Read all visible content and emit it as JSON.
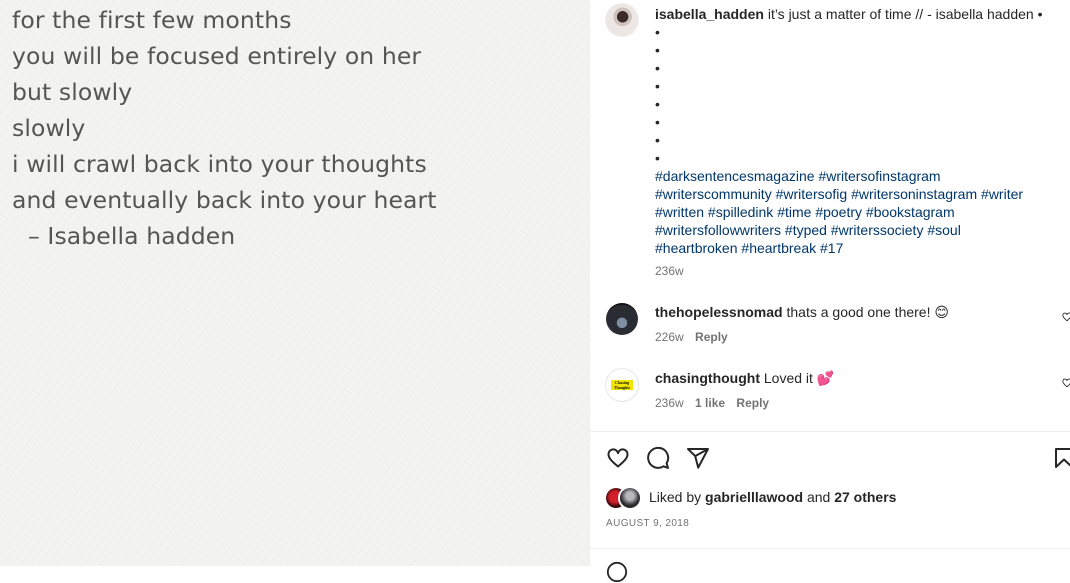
{
  "poem": {
    "lines": [
      "for the first few months",
      "you will be focused entirely on her",
      "but slowly",
      "slowly",
      "i will crawl back into your thoughts",
      "and eventually back into your heart"
    ],
    "author_line": "–   Isabella hadden"
  },
  "caption": {
    "username": "isabella_hadden",
    "text": "it’s just a matter of time // - isabella hadden •",
    "bullets": [
      "•",
      "•",
      "•",
      "•",
      "•",
      "•",
      "•",
      "•"
    ],
    "hashtags": [
      "#darksentencesmagazine",
      "#writersofinstagram",
      "#writerscommunity",
      "#writersofig",
      "#writersoninstagram",
      "#writer",
      "#written",
      "#spilledink",
      "#time",
      "#poetry",
      "#bookstagram",
      "#writersfollowwriters",
      "#typed",
      "#writerssociety",
      "#soul",
      "#heartbroken",
      "#heartbreak",
      "#17"
    ],
    "age": "236w"
  },
  "comments": [
    {
      "username": "thehopelessnomad",
      "text": "thats a good one there! 😊",
      "age": "226w",
      "likes": "",
      "reply_label": "Reply"
    },
    {
      "username": "chasingthought",
      "text": "Loved it 💕",
      "age": "236w",
      "likes": "1 like",
      "reply_label": "Reply",
      "avatar_text": "Chasing Thoughts"
    }
  ],
  "likes": {
    "prefix": "Liked by",
    "user": "gabrielllawood",
    "and": "and",
    "others": "27 others"
  },
  "date": "AUGUST 9, 2018",
  "icons": {
    "like": "heart-icon",
    "comment": "comment-bubble-icon",
    "share": "paper-plane-icon",
    "save": "bookmark-icon",
    "comment_like": "small-heart-icon"
  },
  "colors": {
    "hashtag": "#00376b",
    "secondary_text": "#737373",
    "poem_text": "#555555",
    "primary_text": "#262626"
  }
}
